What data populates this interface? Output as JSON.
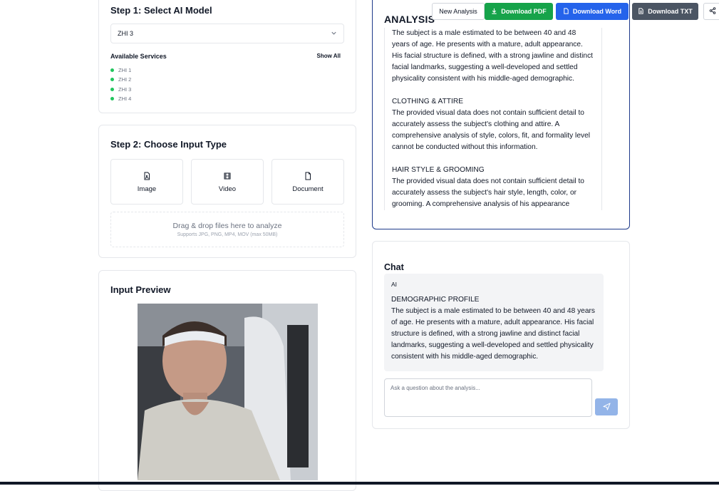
{
  "step1": {
    "title": "Step 1: Select AI Model",
    "selected_model": "ZHI 3",
    "services_title": "Available Services",
    "show_all": "Show All",
    "services": [
      "ZHI 1",
      "ZHI 2",
      "ZHI 3",
      "ZHI 4"
    ],
    "status_color": "#22c55e"
  },
  "step2": {
    "title": "Step 2: Choose Input Type",
    "types": [
      {
        "label": "Image",
        "icon": "image-file-icon"
      },
      {
        "label": "Video",
        "icon": "film-icon"
      },
      {
        "label": "Document",
        "icon": "document-icon"
      }
    ],
    "dropzone_main": "Drag & drop files here to analyze",
    "dropzone_sub": "Supports JPG, PNG, MP4, MOV (max 50MB)"
  },
  "preview": {
    "title": "Input Preview"
  },
  "analysis": {
    "title": "ANALYSIS",
    "buttons": {
      "new": "New Analysis",
      "pdf": "Download PDF",
      "word": "Download Word",
      "txt": "Download TXT"
    },
    "paragraphs": [
      "The subject is a male estimated to be between 40 and 48 years of age. He presents with a mature, adult appearance. His facial structure is defined, with a strong jawline and distinct facial landmarks, suggesting a well-developed and settled physicality consistent with his middle-aged demographic.",
      "CLOTHING & ATTIRE\nThe provided visual data does not contain sufficient detail to accurately assess the subject's clothing and attire. A comprehensive analysis of style, colors, fit, and formality level cannot be conducted without this information.",
      "HAIR STYLE & GROOMING\nThe provided visual data does not contain sufficient detail to accurately assess the subject's hair style, length, color, or grooming. A comprehensive analysis of his appearance"
    ]
  },
  "chat": {
    "title": "Chat",
    "message": {
      "sender": "AI",
      "text": "DEMOGRAPHIC PROFILE\nThe subject is a male estimated to be between 40 and 48 years of age. He presents with a mature, adult appearance. His facial structure is defined, with a strong jawline and distinct facial landmarks, suggesting a well-developed and settled physicality consistent with his middle-aged demographic."
    },
    "input_placeholder": "Ask a question about the analysis...",
    "send_color": "#93b4e8"
  }
}
